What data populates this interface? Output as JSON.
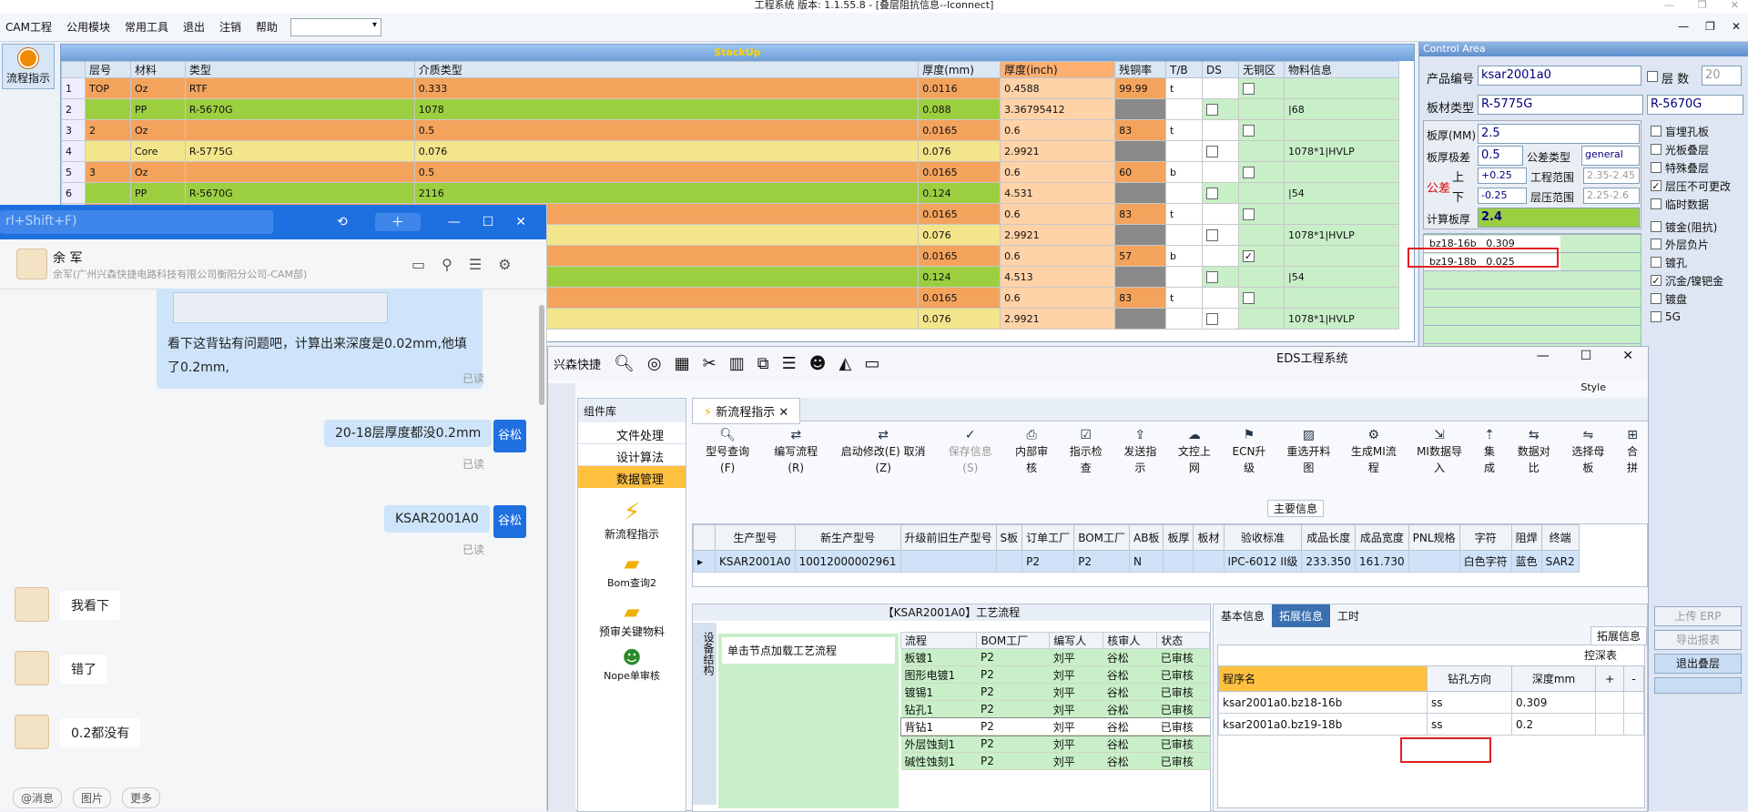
{
  "window_title": "工程系统 版本: 1.1.55.8 - [叠层阻抗信息--Iconnect]",
  "menu": {
    "items": [
      "CAM工程",
      "公用模块",
      "常用工具",
      "退出",
      "注销",
      "帮助"
    ]
  },
  "left_btn": "流程指示",
  "stackup": {
    "title": "StackUp",
    "headers": [
      "层号",
      "材料",
      "类型",
      "介质类型",
      "厚度(mm)",
      "厚度(inch)",
      "残铜率",
      "T/B",
      "DS",
      "无铜区",
      "物料信息"
    ],
    "rows": [
      [
        "1",
        "TOP",
        "Oz",
        "RTF",
        "0.333",
        "0.0116",
        "0.4588",
        "99.99",
        "t",
        "",
        ""
      ],
      [
        "2",
        "",
        "PP",
        "R-5670G",
        "1078",
        "0.088",
        "3.36795412",
        "",
        "",
        "",
        "|68"
      ],
      [
        "3",
        "2",
        "Oz",
        "",
        "0.5",
        "0.0165",
        "0.6",
        "83",
        "t",
        "",
        ""
      ],
      [
        "4",
        "",
        "Core",
        "R-5775G",
        "0.076",
        "0.076",
        "2.9921",
        "",
        "",
        "",
        "1078*1|HVLP"
      ],
      [
        "5",
        "3",
        "Oz",
        "",
        "0.5",
        "0.0165",
        "0.6",
        "60",
        "b",
        "",
        ""
      ],
      [
        "6",
        "",
        "PP",
        "R-5670G",
        "2116",
        "0.124",
        "4.531",
        "",
        "",
        "",
        "|54"
      ],
      [
        "",
        "",
        "",
        "",
        "",
        "0.0165",
        "0.6",
        "83",
        "t",
        "",
        ""
      ],
      [
        "",
        "",
        "",
        "",
        "",
        "0.076",
        "2.9921",
        "",
        "",
        "",
        "1078*1|HVLP"
      ],
      [
        "",
        "",
        "",
        "",
        "",
        "0.0165",
        "0.6",
        "57",
        "b",
        "",
        ""
      ],
      [
        "",
        "",
        "",
        "",
        "",
        "0.124",
        "4.513",
        "",
        "",
        "",
        "|54"
      ],
      [
        "",
        "",
        "",
        "",
        "",
        "0.0165",
        "0.6",
        "83",
        "t",
        "",
        ""
      ],
      [
        "",
        "",
        "",
        "",
        "",
        "0.076",
        "2.9921",
        "",
        "",
        "",
        "1078*1|HVLP"
      ]
    ]
  },
  "control": {
    "title": "Control Area",
    "product_no_label": "产品编号",
    "product_no": "ksar2001a0",
    "layers_label": "层 数",
    "layers": "20",
    "board_type_label": "板材类型",
    "board_type": "R-5775G",
    "board_type2": "R-5670G",
    "thick_label": "板厚(MM)",
    "thick": "2.5",
    "tol_label": "板厚极差",
    "tol": "0.5",
    "tol_type_label": "公差类型",
    "tol_type": "general",
    "gc_label": "公差",
    "up_label": "上",
    "down_label": "下",
    "up": "+0.25",
    "down": "-0.25",
    "eng_range_label": "工程范围",
    "eng_range": "2.35-2.45",
    "press_range_label": "层压范围",
    "press_range": "2.25-2.6",
    "calc_label": "计算板厚",
    "calc": "2.4",
    "list": [
      {
        "name": "bz18-16b",
        "val": "0.309"
      },
      {
        "name": "bz19-18b",
        "val": "0.025"
      }
    ],
    "checks": [
      {
        "label": "盲埋孔板",
        "on": false
      },
      {
        "label": "光板叠层",
        "on": false
      },
      {
        "label": "特殊叠层",
        "on": false
      },
      {
        "label": "层压不可更改",
        "on": true
      },
      {
        "label": "临时数据",
        "on": false
      },
      {
        "label": "镀金(阻抗)",
        "on": false
      },
      {
        "label": "外层负片",
        "on": false
      },
      {
        "label": "镀孔",
        "on": false
      },
      {
        "label": "沉金/镍钯金",
        "on": true
      },
      {
        "label": "镀盘",
        "on": false
      },
      {
        "label": "5G",
        "on": false
      }
    ],
    "buttons": [
      "上传 ERP",
      "导出报表",
      "退出叠层"
    ]
  },
  "chat": {
    "search_placeholder": "rl+Shift+F)",
    "name": "余 军",
    "sub": "余军(广州兴森快捷电路科技有限公司衡阳分公司-CAM部)",
    "msg1": "看下这背钻有问题吧，计算出来深度是0.02mm,他填了0.2mm,",
    "msg2": "20-18层厚度都没0.2mm",
    "msg3": "KSAR2001A0",
    "me": "谷松",
    "read": "已读",
    "r1": "我看下",
    "r2": "错了",
    "r3": "0.2都没有",
    "bottom": [
      "@消息",
      "图片",
      "更多"
    ]
  },
  "eds": {
    "title": "EDS工程系统",
    "brand": "兴森快捷",
    "style": "Style",
    "side": {
      "head": "组件库",
      "items": [
        "文件处理",
        "设计算法",
        "数据管理"
      ],
      "icons": [
        "新流程指示",
        "Bom查询2",
        "预审关键物料",
        "Nope单审核"
      ]
    },
    "tab": "新流程指示",
    "ribbon": [
      "型号查询(F)",
      "编写流程(R)",
      "启动修改(E) 取消(Z)",
      "保存信息(S)",
      "内部审核",
      "指示检查",
      "发送指示",
      "文控上网",
      "ECN升级",
      "重选开料图",
      "生成MI流程",
      "MI数据导入",
      "集成",
      "数据对比",
      "选择母板",
      "合拼"
    ],
    "main_info": "主要信息",
    "grid_headers": [
      "生产型号",
      "新生产型号",
      "升级前旧生产型号",
      "S板",
      "订单工厂",
      "BOM工厂",
      "AB板",
      "板厚",
      "板材",
      "验收标准",
      "成品长度",
      "成品宽度",
      "PNL规格",
      "字符",
      "阻焊",
      "终端"
    ],
    "grid_row": [
      "KSAR2001A0",
      "10012000002961",
      "",
      "",
      "P2",
      "P2",
      "N",
      "",
      "",
      "IPC-6012 II级",
      "233.350",
      "161.730",
      "",
      "白色字符",
      "蓝色",
      "SAR2"
    ],
    "flow_title": "【KSAR2001A0】工艺流程",
    "device_tab": "设备结构",
    "load_hint": "单击节点加载工艺流程",
    "tree_headers": [
      "流程",
      "BOM工厂",
      "编写人",
      "核审人",
      "状态"
    ],
    "tree": [
      [
        "板镀1",
        "P2",
        "刘平",
        "谷松",
        "已审核"
      ],
      [
        "图形电镀1",
        "P2",
        "刘平",
        "谷松",
        "已审核"
      ],
      [
        "镀锡1",
        "P2",
        "刘平",
        "谷松",
        "已审核"
      ],
      [
        "钻孔1",
        "P2",
        "刘平",
        "谷松",
        "已审核"
      ],
      [
        "背钻1",
        "P2",
        "刘平",
        "谷松",
        "已审核"
      ],
      [
        "外层蚀刻1",
        "P2",
        "刘平",
        "谷松",
        "已审核"
      ],
      [
        "碱性蚀刻1",
        "P2",
        "刘平",
        "谷松",
        "已审核"
      ]
    ],
    "rtabs": [
      "基本信息",
      "拓展信息",
      "工时"
    ],
    "ext_btn": "拓展信息",
    "drill_title": "控深表",
    "drill_headers": [
      "程序名",
      "钻孔方向",
      "深度mm",
      "+",
      "-"
    ],
    "drill_rows": [
      [
        "ksar2001a0.bz18-16b",
        "ss",
        "0.309",
        "",
        ""
      ],
      [
        "ksar2001a0.bz19-18b",
        "ss",
        "0.2",
        "",
        ""
      ]
    ]
  }
}
